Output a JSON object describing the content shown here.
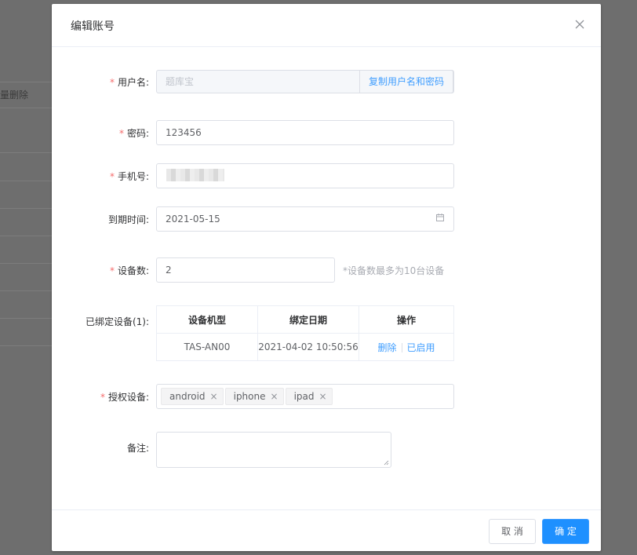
{
  "background": {
    "bulk_delete_text": "批量删除"
  },
  "dialog": {
    "title": "编辑账号",
    "close_icon": "close-icon"
  },
  "form": {
    "username": {
      "label": "用户名",
      "value": "题库宝",
      "copy_button": "复制用户名和密码",
      "required": true
    },
    "password": {
      "label": "密码",
      "value": "123456",
      "required": true
    },
    "phone": {
      "label": "手机号",
      "value": "",
      "required": true
    },
    "expire": {
      "label": "到期时间",
      "value": "2021-05-15",
      "icon": "calendar-icon"
    },
    "device_count": {
      "label": "设备数",
      "value": "2",
      "hint": "*设备数最多为10台设备",
      "required": true
    },
    "bound_devices": {
      "label": "已绑定设备(1)",
      "columns": [
        "设备机型",
        "绑定日期",
        "操作"
      ],
      "rows": [
        {
          "model": "TAS-AN00",
          "date": "2021-04-02 10:50:56",
          "delete": "删除",
          "status": "已启用"
        }
      ]
    },
    "authorized": {
      "label": "授权设备",
      "required": true,
      "tags": [
        "android",
        "iphone",
        "ipad"
      ]
    },
    "remark": {
      "label": "备注",
      "value": ""
    },
    "colon": ":"
  },
  "footer": {
    "cancel": "取 消",
    "confirm": "确 定"
  },
  "colors": {
    "primary": "#409eff",
    "confirm_bg": "#1e90ff",
    "required": "#f56c6c"
  }
}
